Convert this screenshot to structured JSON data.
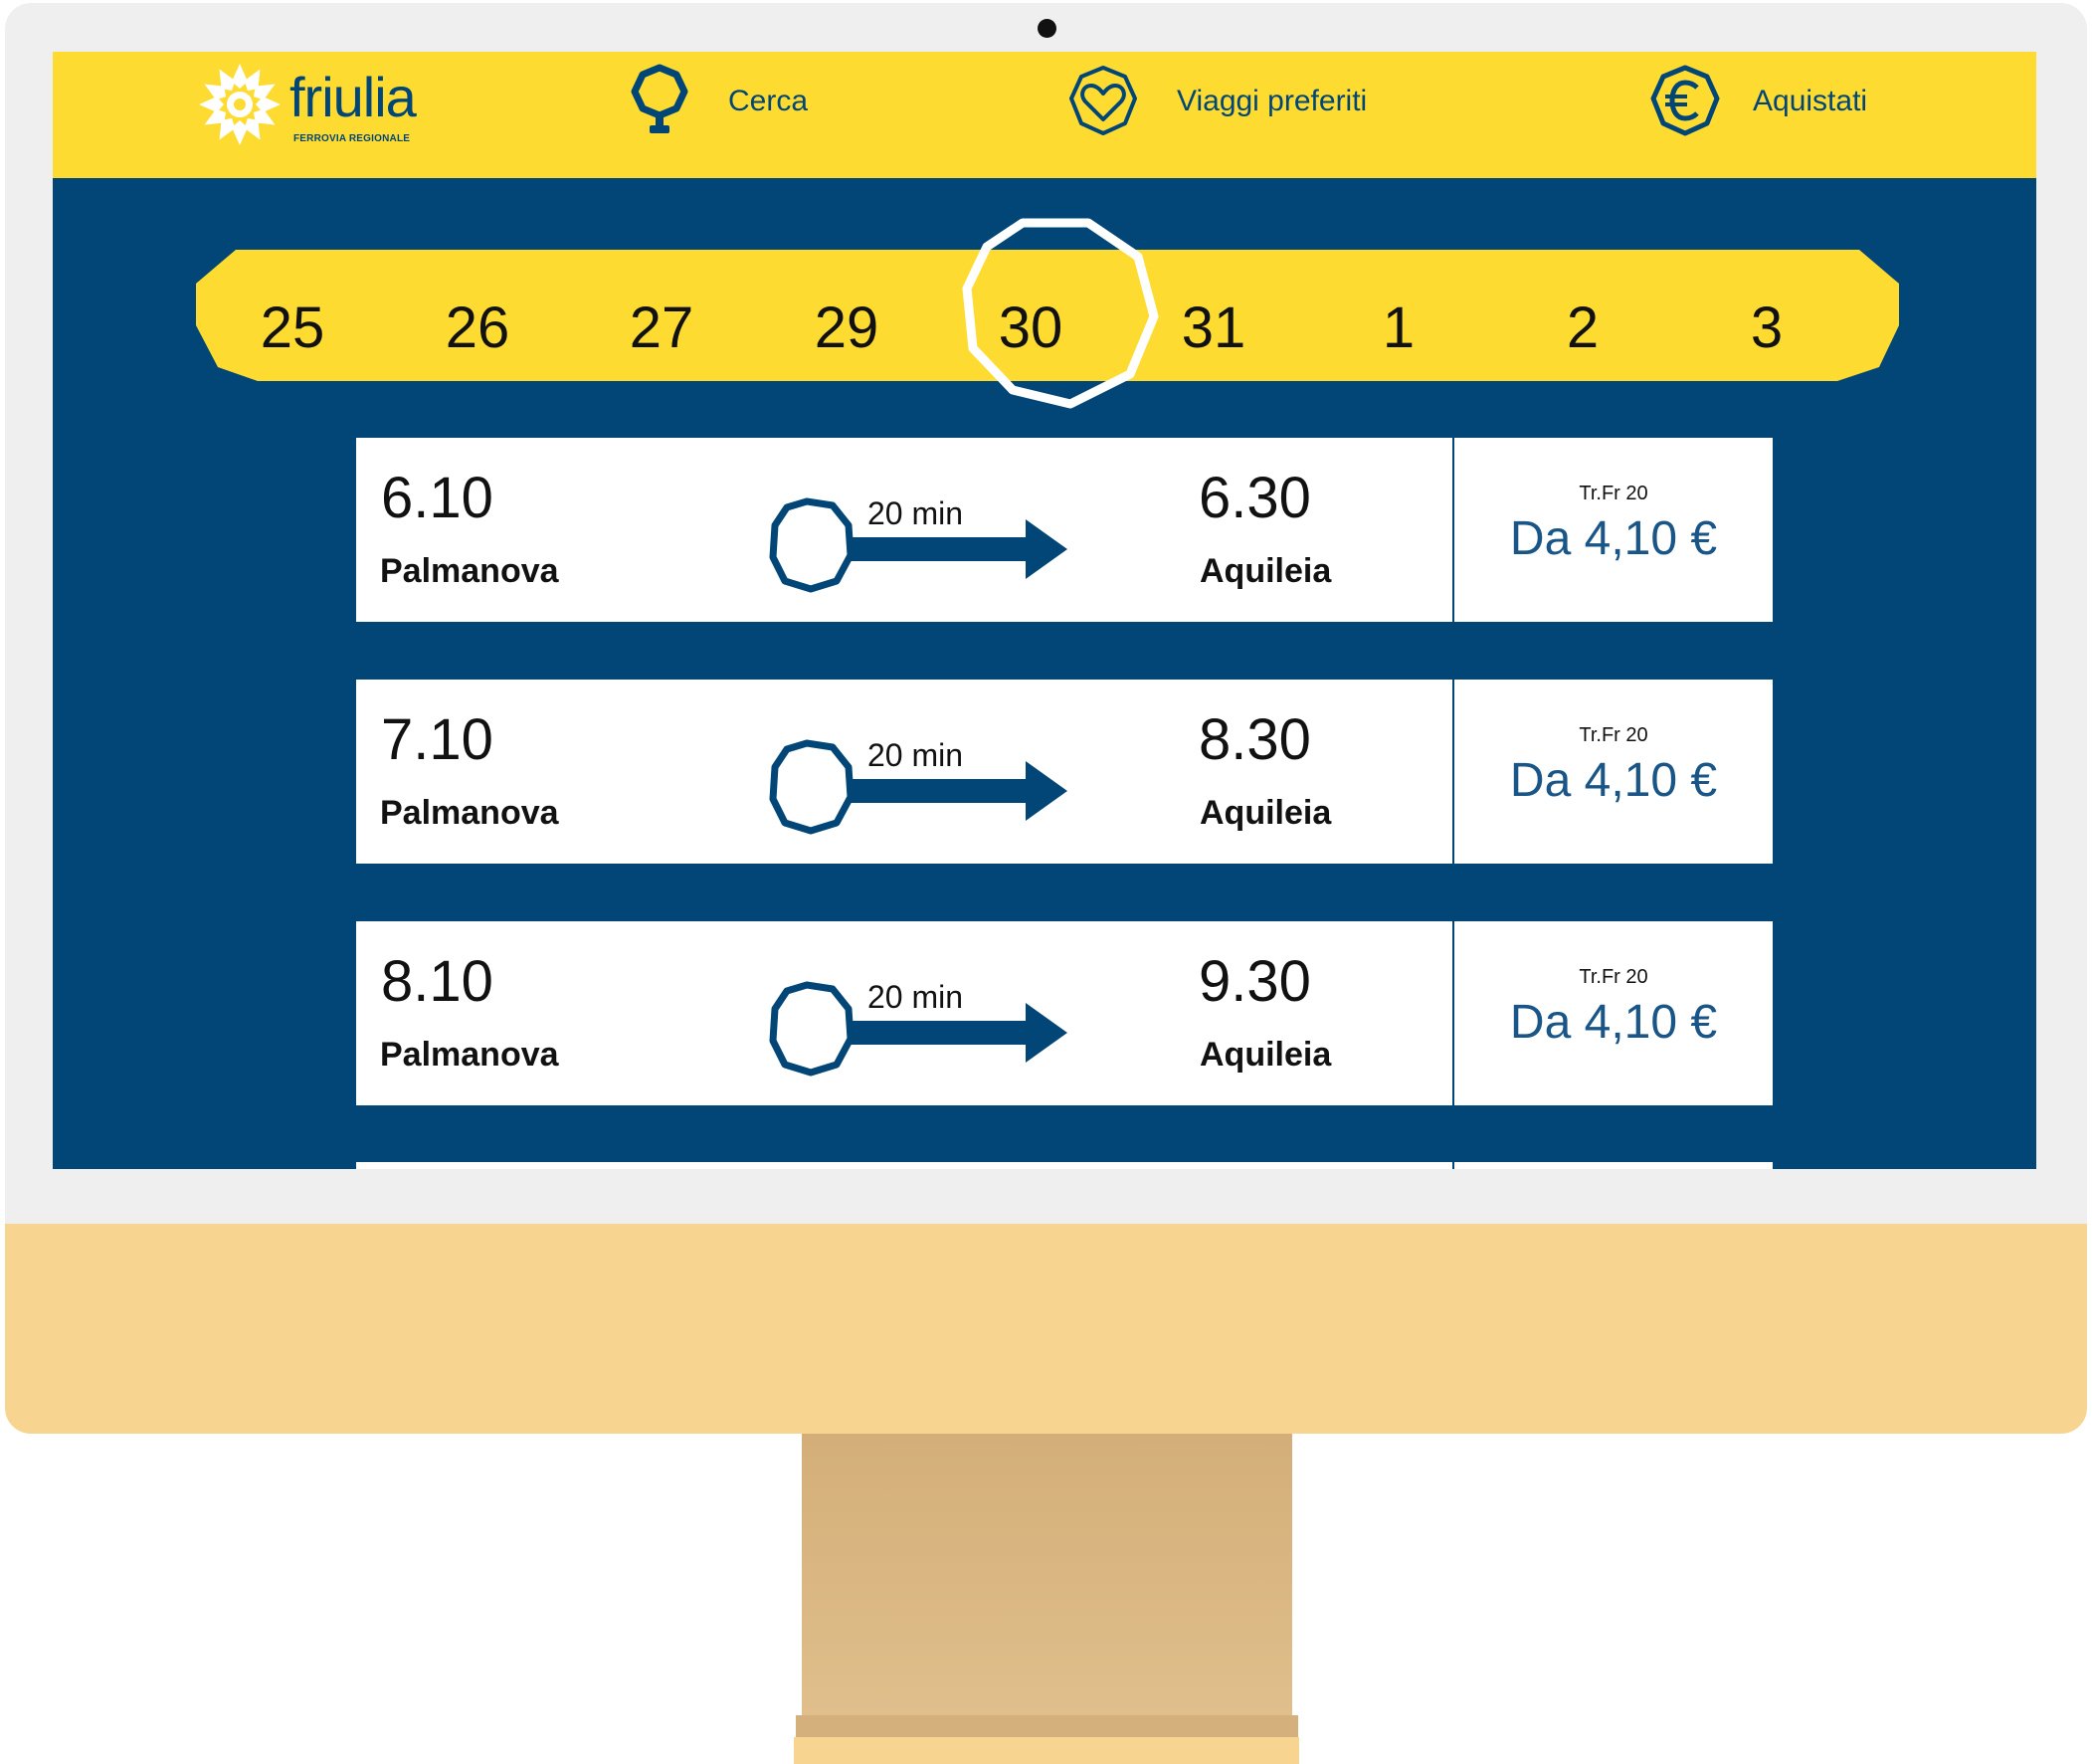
{
  "brand": {
    "name": "friulia",
    "subtitle": "FERROVIA REGIONALE",
    "colors": {
      "yellow": "#fedb31",
      "blue": "#014677",
      "price_blue": "#1a5587"
    }
  },
  "nav": [
    {
      "label": "Cerca",
      "icon": "search-icon"
    },
    {
      "label": "Viaggi preferiti",
      "icon": "heart-icon"
    },
    {
      "label": "Aquistati",
      "icon": "euro-icon"
    }
  ],
  "dates": [
    "25",
    "26",
    "27",
    "29",
    "30",
    "31",
    "1",
    "2",
    "3"
  ],
  "selected_date": "30",
  "trips": [
    {
      "departure_time": "6.10",
      "departure_station": "Palmanova",
      "duration": "20 min",
      "arrival_time": "6.30",
      "arrival_station": "Aquileia",
      "fare_class": "Tr.Fr 20",
      "price": "Da 4,10 €"
    },
    {
      "departure_time": "7.10",
      "departure_station": "Palmanova",
      "duration": "20 min",
      "arrival_time": "8.30",
      "arrival_station": "Aquileia",
      "fare_class": "Tr.Fr 20",
      "price": "Da 4,10 €"
    },
    {
      "departure_time": "8.10",
      "departure_station": "Palmanova",
      "duration": "20 min",
      "arrival_time": "9.30",
      "arrival_station": "Aquileia",
      "fare_class": "Tr.Fr 20",
      "price": "Da 4,10 €"
    }
  ]
}
